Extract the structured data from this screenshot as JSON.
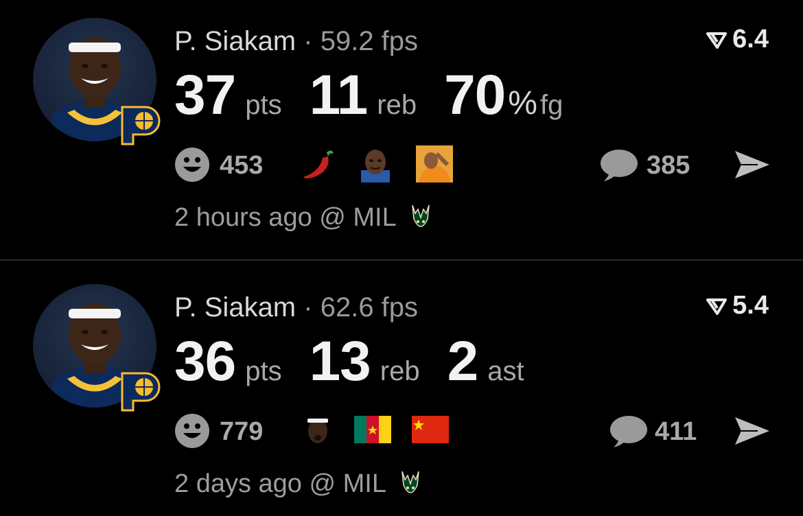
{
  "posts": [
    {
      "player": "P. Siakam",
      "separator": "·",
      "fps": "59.2 fps",
      "score": "6.4",
      "stats": [
        {
          "value": "37",
          "unit": "pts"
        },
        {
          "value": "11",
          "unit": "reb"
        },
        {
          "value": "70",
          "pct": "%",
          "unit": "fg"
        }
      ],
      "reactions_count": "453",
      "reaction_emojis": [
        "hot-pepper",
        "shaq-face",
        "drake-meme"
      ],
      "comments_count": "385",
      "time_text": "2 hours ago @ MIL"
    },
    {
      "player": "P. Siakam",
      "separator": "·",
      "fps": "62.6 fps",
      "score": "5.4",
      "stats": [
        {
          "value": "36",
          "unit": "pts"
        },
        {
          "value": "13",
          "unit": "reb"
        },
        {
          "value": "2",
          "unit": "ast"
        }
      ],
      "reactions_count": "779",
      "reaction_emojis": [
        "siakam-face",
        "flag-cameroon",
        "flag-china"
      ],
      "comments_count": "411",
      "time_text": "2 days ago @ MIL"
    }
  ],
  "colors": {
    "background": "#000000",
    "muted": "#9a9a9a",
    "text": "#f2f2f2",
    "pacers_navy": "#002d62",
    "pacers_gold": "#fdbb30",
    "bucks_green": "#00471b"
  }
}
